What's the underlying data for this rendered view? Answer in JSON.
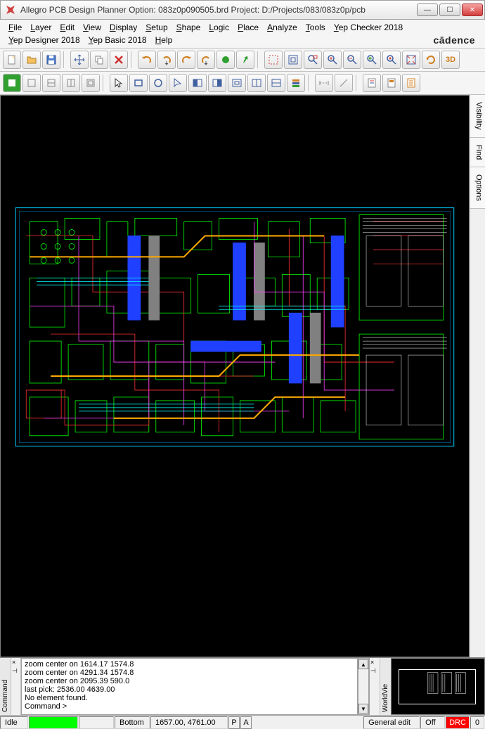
{
  "title": "Allegro PCB Design Planner Option: 083z0p090505.brd   Project: D:/Projects/083/083z0p/pcb",
  "menu": {
    "items": [
      "File",
      "Layer",
      "Edit",
      "View",
      "Display",
      "Setup",
      "Shape",
      "Logic",
      "Place",
      "Analyze",
      "Tools",
      "Yep Checker 2018"
    ],
    "items2": [
      "Yep Designer 2018",
      "Yep Basic 2018",
      "Help"
    ]
  },
  "brand": "cādence",
  "side_tabs": [
    "Visibility",
    "Find",
    "Options"
  ],
  "command": {
    "tab": "Command",
    "lines": [
      "zoom center on 1614.17 1574.8",
      "zoom center on 4291.34 1574.8",
      "zoom center on 2095.39 590.0",
      "last pick:  2536.00 4639.00",
      "No element found.",
      "Command >"
    ]
  },
  "worldview": {
    "tab": "WorldVie"
  },
  "status": {
    "idle": "Idle",
    "layer": "Bottom",
    "coords": "1657.00, 4761.00",
    "p": "P",
    "a": "A",
    "mode": "General edit",
    "off": "Off",
    "drc": "DRC",
    "zero": "0"
  },
  "icons": {
    "new": "new-icon",
    "open": "open-icon",
    "save": "save-icon",
    "move": "move-icon",
    "copy": "copy-icon",
    "delete": "delete-icon",
    "undo": "undo-icon",
    "redo": "redo-icon",
    "zoomfit": "zoom-fit-icon",
    "zoomin": "zoom-in-icon",
    "zoomout": "zoom-out-icon",
    "3d": "3d-icon"
  }
}
